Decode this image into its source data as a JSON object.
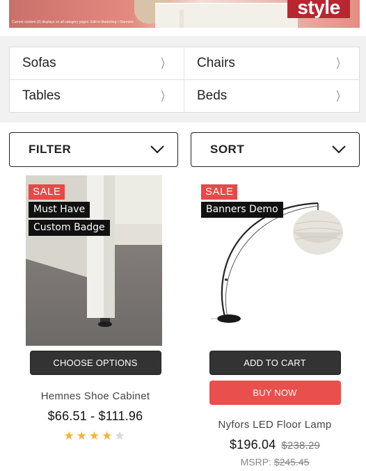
{
  "hero": {
    "fine_print": "Current content (0) displays on all category pages. Edit in Marketing > Banners",
    "brand_word": "style"
  },
  "categories": [
    {
      "label": "Sofas"
    },
    {
      "label": "Chairs"
    },
    {
      "label": "Tables"
    },
    {
      "label": "Beds"
    }
  ],
  "controls": {
    "filter_label": "FILTER",
    "sort_label": "SORT"
  },
  "products": [
    {
      "badges": {
        "sale": "SALE",
        "extra": [
          "Must Have",
          "Custom Badge"
        ]
      },
      "button": "CHOOSE OPTIONS",
      "name": "Hemnes Shoe Cabinet",
      "price": "$66.51 - $111.96",
      "rating": 4,
      "rating_max": 5
    },
    {
      "badges": {
        "sale": "SALE",
        "extra": [
          "Banners Demo"
        ]
      },
      "button": "ADD TO CART",
      "button_secondary": "BUY NOW",
      "name": "Nyfors LED Floor Lamp",
      "price": "$196.04",
      "price_was": "$238.29",
      "msrp_label": "MSRP:",
      "msrp_value": "$245.45"
    }
  ],
  "colors": {
    "sale_badge": "#e94848",
    "buy_now": "#e94f4c",
    "dark_button": "#333333",
    "star": "#f2b43c"
  }
}
